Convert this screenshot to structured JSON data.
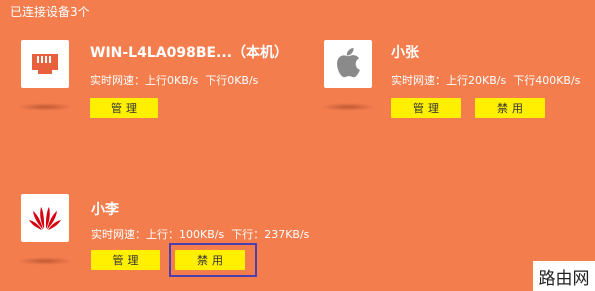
{
  "header": {
    "connected_label": "已连接设备3个"
  },
  "devices": [
    {
      "name": "WIN-L4LA098BE...（本机）",
      "speed_label": "实时网速：",
      "upload": "上行0KB/s",
      "download": "下行0KB/s",
      "icon": "ethernet-port-icon",
      "manage_label": "管理"
    },
    {
      "name": "小张",
      "speed_label": "实时网速：",
      "upload": "上行20KB/s",
      "download": "下行400KB/s",
      "icon": "apple-icon",
      "manage_label": "管理",
      "block_label": "禁用"
    },
    {
      "name": "小李",
      "speed_label": "实时网速：",
      "upload": "上行：100KB/s",
      "download": "下行：237KB/s",
      "icon": "huawei-icon",
      "manage_label": "管理",
      "block_label": "禁用"
    }
  ],
  "watermark": "路由网",
  "colors": {
    "background": "#f47d4e",
    "button": "#ffef00",
    "highlight": "#4b3fb0",
    "ethernet_icon": "#e8603c",
    "apple_icon": "#8a8a8a",
    "huawei_icon": "#d7000f"
  }
}
